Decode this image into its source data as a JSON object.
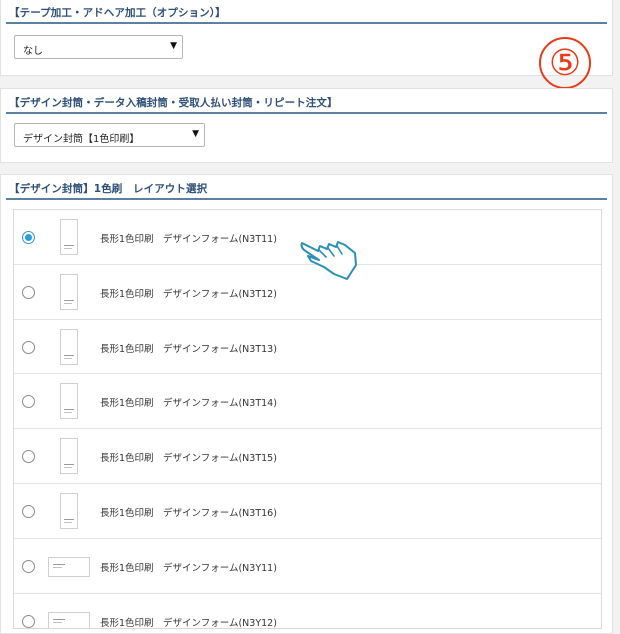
{
  "tape_section": {
    "title": "【テープ加工・アドヘア加工（オプション）】",
    "select_value": "なし"
  },
  "step_marker": "⑤",
  "design_section": {
    "title": "【デザイン封筒・データ入稿封筒・受取人払い封筒・リピート注文】",
    "select_value": "デザイン封筒【1色印刷】"
  },
  "layout_section": {
    "title": "【デザイン封筒】1色刷　レイアウト選択",
    "options": [
      {
        "label": "長形1色印刷　デザインフォーム(N3T11)",
        "selected": true,
        "orientation": "vertical"
      },
      {
        "label": "長形1色印刷　デザインフォーム(N3T12)",
        "selected": false,
        "orientation": "vertical"
      },
      {
        "label": "長形1色印刷　デザインフォーム(N3T13)",
        "selected": false,
        "orientation": "vertical"
      },
      {
        "label": "長形1色印刷　デザインフォーム(N3T14)",
        "selected": false,
        "orientation": "vertical"
      },
      {
        "label": "長形1色印刷　デザインフォーム(N3T15)",
        "selected": false,
        "orientation": "vertical"
      },
      {
        "label": "長形1色印刷　デザインフォーム(N3T16)",
        "selected": false,
        "orientation": "vertical"
      },
      {
        "label": "長形1色印刷　デザインフォーム(N3Y11)",
        "selected": false,
        "orientation": "horizontal"
      },
      {
        "label": "長形1色印刷　デザインフォーム(N3Y12)",
        "selected": false,
        "orientation": "horizontal"
      }
    ]
  },
  "colors": {
    "heading": "#2d4f78",
    "marker": "#e83a18",
    "radio_selected": "#29a0d8",
    "cursor": "#2a8fb5"
  },
  "icons": {
    "dropdown": "caret-down-icon",
    "cursor": "pointing-hand-cursor-icon"
  }
}
